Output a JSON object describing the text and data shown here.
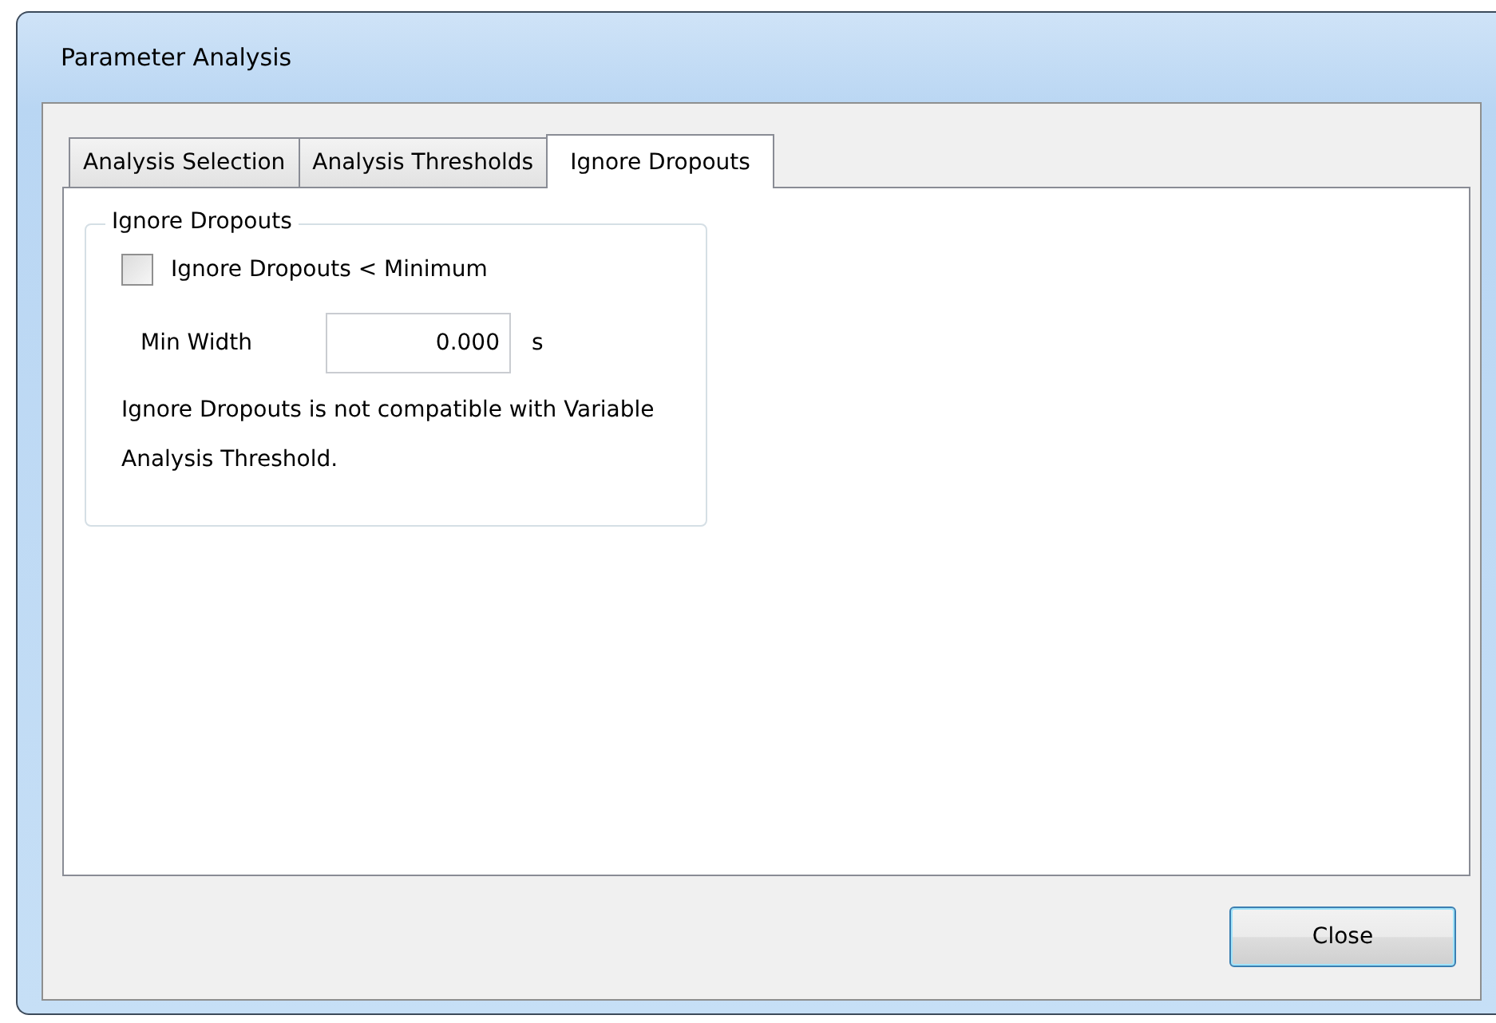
{
  "window": {
    "title": "Parameter Analysis"
  },
  "tabs": [
    {
      "label": "Analysis Selection",
      "selected": false
    },
    {
      "label": "Analysis Thresholds",
      "selected": false
    },
    {
      "label": "Ignore Dropouts",
      "selected": true
    }
  ],
  "group": {
    "title": "Ignore Dropouts",
    "checkbox": {
      "label": "Ignore Dropouts < Minimum",
      "checked": false
    },
    "field": {
      "label": "Min Width",
      "value": "0.000",
      "unit": "s"
    },
    "note": "Ignore Dropouts is not compatible with Variable Analysis Threshold."
  },
  "buttons": [
    "Close"
  ]
}
